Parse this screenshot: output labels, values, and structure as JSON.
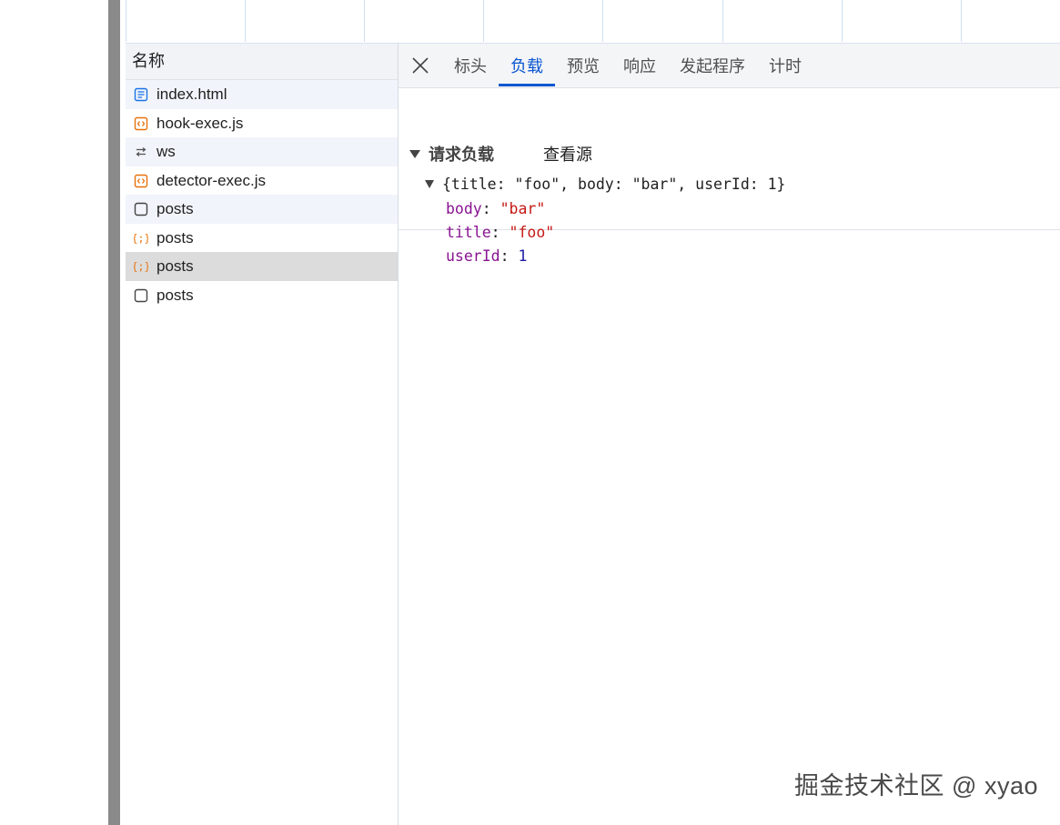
{
  "requests": {
    "header": "名称",
    "items": [
      {
        "name": "index.html",
        "icon": "document-icon"
      },
      {
        "name": "hook-exec.js",
        "icon": "script-icon"
      },
      {
        "name": "ws",
        "icon": "websocket-icon"
      },
      {
        "name": "detector-exec.js",
        "icon": "script-icon"
      },
      {
        "name": "posts",
        "icon": "blank-file-icon"
      },
      {
        "name": "posts",
        "icon": "json-icon"
      },
      {
        "name": "posts",
        "icon": "json-icon"
      },
      {
        "name": "posts",
        "icon": "blank-file-icon"
      }
    ]
  },
  "tabs": [
    "标头",
    "负载",
    "预览",
    "响应",
    "发起程序",
    "计时"
  ],
  "active_tab": "负载",
  "payload": {
    "section_title": "请求负载",
    "view_source": "查看源",
    "summary": "{title: \"foo\", body: \"bar\", userId: 1}",
    "props": [
      {
        "key": "body",
        "colon": ": ",
        "value": "\"bar\"",
        "type": "string"
      },
      {
        "key": "title",
        "colon": ": ",
        "value": "\"foo\"",
        "type": "string"
      },
      {
        "key": "userId",
        "colon": ": ",
        "value": "1",
        "type": "number"
      }
    ]
  },
  "watermark": "掘金技术社区 @ xyao",
  "colors": {
    "accent": "#0b57d0",
    "script_icon": "#e8710a",
    "doc_icon": "#1a73e8",
    "selected_row": "#dcdcdc"
  }
}
